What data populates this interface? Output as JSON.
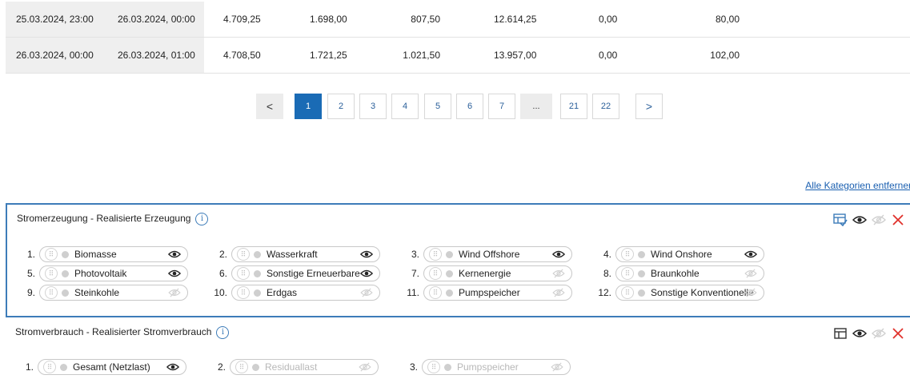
{
  "table": {
    "rows": [
      [
        "25.03.2024, 23:00",
        "26.03.2024, 00:00",
        "4.709,25",
        "1.698,00",
        "807,50",
        "12.614,25",
        "0,00",
        "80,00"
      ],
      [
        "26.03.2024, 00:00",
        "26.03.2024, 01:00",
        "4.708,50",
        "1.721,25",
        "1.021,50",
        "13.957,00",
        "0,00",
        "102,00"
      ]
    ]
  },
  "pagination": {
    "prev": "<",
    "next": ">",
    "pages": [
      "1",
      "2",
      "3",
      "4",
      "5",
      "6",
      "7",
      "...",
      "21",
      "22"
    ],
    "active": "1"
  },
  "remove_all_label": "Alle Kategorien entferner",
  "panels": [
    {
      "title": "Stromerzeugung - Realisierte Erzeugung",
      "info": "i",
      "items": [
        {
          "num": "1.",
          "label": "Biomasse",
          "visible": true
        },
        {
          "num": "2.",
          "label": "Wasserkraft",
          "visible": true
        },
        {
          "num": "3.",
          "label": "Wind Offshore",
          "visible": true
        },
        {
          "num": "4.",
          "label": "Wind Onshore",
          "visible": true
        },
        {
          "num": "5.",
          "label": "Photovoltaik",
          "visible": true
        },
        {
          "num": "6.",
          "label": "Sonstige Erneuerbare",
          "visible": true
        },
        {
          "num": "7.",
          "label": "Kernenergie",
          "visible": false
        },
        {
          "num": "8.",
          "label": "Braunkohle",
          "visible": false
        },
        {
          "num": "9.",
          "label": "Steinkohle",
          "visible": false
        },
        {
          "num": "10.",
          "label": "Erdgas",
          "visible": false
        },
        {
          "num": "11.",
          "label": "Pumpspeicher",
          "visible": false
        },
        {
          "num": "12.",
          "label": "Sonstige Konventionelle",
          "visible": false
        }
      ]
    },
    {
      "title": "Stromverbrauch - Realisierter Stromverbrauch",
      "info": "i",
      "items": [
        {
          "num": "1.",
          "label": "Gesamt (Netzlast)",
          "visible": true,
          "dim": false
        },
        {
          "num": "2.",
          "label": "Residuallast",
          "visible": false,
          "dim": true
        },
        {
          "num": "3.",
          "label": "Pumpspeicher",
          "visible": false,
          "dim": true
        }
      ]
    }
  ],
  "icons": {
    "drag": "drag-handle-icon",
    "eye": "eye-icon",
    "eye_off": "eye-off-icon",
    "close": "close-icon",
    "chart_check": "chart-check-icon",
    "table_layout": "table-layout-icon",
    "info": "info-icon"
  },
  "colors": {
    "accent": "#1a6bb5",
    "panel_border": "#3d7cb9",
    "close_red": "#e0312b",
    "link": "#1a5fb0"
  }
}
